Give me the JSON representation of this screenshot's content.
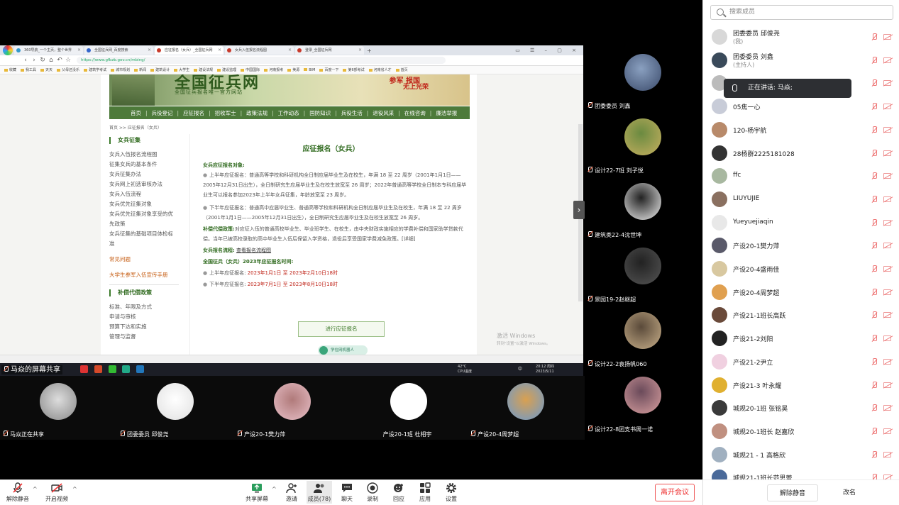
{
  "browser": {
    "tabs": [
      {
        "label": "360导航_一个主页，整个世界"
      },
      {
        "label": "全国征兵网_百度搜索"
      },
      {
        "label": "应征报名（女兵）_全国征兵网"
      },
      {
        "label": "女兵入伍报名流程图"
      },
      {
        "label": "登录_全国征兵网"
      }
    ],
    "url": "https://www.gfbzb.gov.cn/mbing/",
    "bookmarks": [
      "收藏",
      "我工具",
      "天天",
      "父母还没乐",
      "建筑学考试",
      "城市规划",
      "新闻",
      "建筑设计",
      "大学生",
      "建设法规",
      "建设监理",
      "中国国际",
      "河南报考",
      "美源",
      "BIM",
      "百度一下",
      "第6部考试",
      "河南省人才",
      "首页"
    ]
  },
  "site": {
    "title": "全国征兵网",
    "subtitle": "全国征兵报名唯一官方网站",
    "slogan1": "参军 报国",
    "slogan2": "无上光荣",
    "nav": [
      "首页",
      "兵役登记",
      "应征报名",
      "招收军士",
      "政策法规",
      "工作动态",
      "国防知识",
      "兵役生活",
      "退役风采",
      "在线咨询",
      "廉洁举报"
    ],
    "breadcrumb": "首页  >>  应征报名（女兵）",
    "sidebar": {
      "head1": "女兵征集",
      "items1": [
        "女兵入伍报名流程图",
        "征集女兵的基本条件",
        "女兵征集办法",
        "女兵网上初选审核办法",
        "女兵入伍流程",
        "女兵优先征集对象",
        "女兵优先征集对象享受的优",
        "先政策",
        "女兵征集的基础项目体检标",
        "准"
      ],
      "link1": "常见问题",
      "link2": "大学生参军入伍宣传手册",
      "head2": "补偿代偿政策",
      "items2": [
        "标准、年限及方式",
        "申请与审核",
        "预算下达和实施",
        "管理与监督"
      ]
    },
    "content": {
      "title": "应征报名（女兵）",
      "obj_head": "女兵应征报名对象:",
      "p1": "上半年应征报名：普通高等学校和科研机构全日制应届毕业生及在校生，年满 18 至 22 周岁（2001年1月1日——2005年12月31日出生），全日制研究生应届毕业生及在校生放宽至 26 周岁；2022年普通高等学校全日制本专科应届毕业生可以报名参加2023年上半年女兵征集，年龄放宽至 23 周岁。",
      "p2": "下半年应征报名：普通高中应届毕业生、普通高等学校和科研机构全日制应届毕业生及在校生，年满 18 至 22 周岁（2001年1月1日——2005年12月31日出生），全日制研究生应届毕业生及在校生放宽至 26 周岁。",
      "comp_head": "补偿代偿政策:",
      "comp_text": "对应征入伍的普通高校毕业生、毕业班学生、在校生，由中央财政实施相应的学费补偿和国家助学贷款代偿。当年已被高校录取的高中毕业生入伍后保留入学资格，退役后享受国家学费减免政策。[详细]",
      "flow_head": "女兵报名流程:",
      "flow_link": "查看报名流程图",
      "time_head": "全国征兵（女兵）2023年应征报名时间:",
      "t1_label": "上半年应征报名:",
      "t1_value": "2023年1月1日 至 2023年2月10日18时",
      "t2_label": "下半年应征报名:",
      "t2_value": "2023年7月1日 至 2023年8月10日18时",
      "apply_button": "进行应征报名",
      "robot": "学位网机器人"
    }
  },
  "os": {
    "watermark1": "激活 Windows",
    "watermark2": "转到\"设置\"以激活 Windows。",
    "temp": "42°C",
    "temp_label": "CPU温度",
    "time": "20:12 周四",
    "date": "2023/5/11",
    "ime": "中"
  },
  "share_label": "马焱的屏幕共享",
  "right_tiles": [
    {
      "name": "团委委员 刘鑫"
    },
    {
      "name": "设计22-7班 刘子悦"
    },
    {
      "name": "建筑类22-4沈世坤"
    },
    {
      "name": "景园19-2赵继超"
    },
    {
      "name": "设计22-2袁扬帆060"
    },
    {
      "name": "设计22-8团支书周一诺"
    }
  ],
  "bottom_tiles": [
    {
      "name": "马焱正在共享"
    },
    {
      "name": "团委委员 邱俊尧"
    },
    {
      "name": "产设20-1樊力萍"
    },
    {
      "name": "产设20-1班 杜相宇"
    },
    {
      "name": "产设20-4周梦超"
    }
  ],
  "toolbar": {
    "unmute": "解除静音",
    "video": "开启视频",
    "share": "共享屏幕",
    "invite": "邀请",
    "members": "成员(78)",
    "chat": "聊天",
    "record": "录制",
    "reply": "回应",
    "apps": "应用",
    "settings": "设置",
    "leave": "离开会议"
  },
  "panel": {
    "search_placeholder": "搜索成员",
    "speaking_label": "正在讲话:  马焱;",
    "members": [
      {
        "name": "团委委员 邱俊尧",
        "sub": "(我)"
      },
      {
        "name": "团委委员 刘鑫",
        "sub": "(主持人)"
      },
      {
        "name": "",
        "sub": ""
      },
      {
        "name": "05焦一心",
        "sub": ""
      },
      {
        "name": "120-杨宇航",
        "sub": ""
      },
      {
        "name": "28杨群2225181028",
        "sub": ""
      },
      {
        "name": "ffc",
        "sub": ""
      },
      {
        "name": "LIUYUJIE",
        "sub": ""
      },
      {
        "name": "Yueyuejiaqin",
        "sub": ""
      },
      {
        "name": "产设20-1樊力萍",
        "sub": ""
      },
      {
        "name": "产设20-4盛雨佳",
        "sub": ""
      },
      {
        "name": "产设20-4周梦超",
        "sub": ""
      },
      {
        "name": "产设21-1班长高跃",
        "sub": ""
      },
      {
        "name": "产设21-2刘阳",
        "sub": ""
      },
      {
        "name": "产设21-2尹立",
        "sub": ""
      },
      {
        "name": "产设21-3 叶永耀",
        "sub": ""
      },
      {
        "name": "城规20-1班 张铭昊",
        "sub": ""
      },
      {
        "name": "城规20-1班长 赵嘉欣",
        "sub": ""
      },
      {
        "name": "城规21 - 1 高格欣",
        "sub": ""
      },
      {
        "name": "城规21-1班长范思蕾",
        "sub": ""
      }
    ],
    "unmute_all": "解除静音",
    "rename": "改名"
  },
  "colors": {
    "site_green": "#4d7a3a",
    "leave_red": "#e33333",
    "mute_red": "#e77777"
  }
}
